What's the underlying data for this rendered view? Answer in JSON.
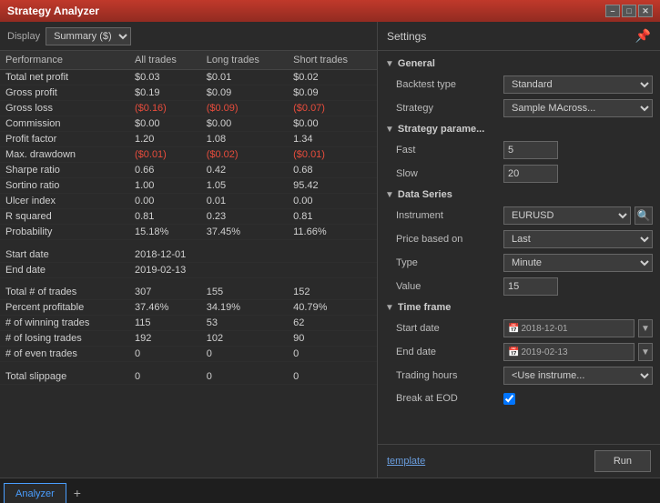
{
  "window": {
    "title": "Strategy Analyzer"
  },
  "toolbar": {
    "display_label": "Display",
    "summary_option": "Summary ($)"
  },
  "table": {
    "headers": [
      "Performance",
      "All trades",
      "Long trades",
      "Short trades"
    ],
    "section_performance": "Performance",
    "rows": [
      {
        "label": "Total net profit",
        "all": "$0.03",
        "long": "$0.01",
        "short": "$0.02",
        "all_red": false,
        "long_red": false,
        "short_red": false
      },
      {
        "label": "Gross profit",
        "all": "$0.19",
        "long": "$0.09",
        "short": "$0.09",
        "all_red": false,
        "long_red": false,
        "short_red": false
      },
      {
        "label": "Gross loss",
        "all": "($0.16)",
        "long": "($0.09)",
        "short": "($0.07)",
        "all_red": true,
        "long_red": true,
        "short_red": true
      },
      {
        "label": "Commission",
        "all": "$0.00",
        "long": "$0.00",
        "short": "$0.00",
        "all_red": false,
        "long_red": false,
        "short_red": false
      },
      {
        "label": "Profit factor",
        "all": "1.20",
        "long": "1.08",
        "short": "1.34",
        "all_red": false,
        "long_red": false,
        "short_red": false
      },
      {
        "label": "Max. drawdown",
        "all": "($0.01)",
        "long": "($0.02)",
        "short": "($0.01)",
        "all_red": true,
        "long_red": true,
        "short_red": true
      },
      {
        "label": "Sharpe ratio",
        "all": "0.66",
        "long": "0.42",
        "short": "0.68",
        "all_red": false,
        "long_red": false,
        "short_red": false
      },
      {
        "label": "Sortino ratio",
        "all": "1.00",
        "long": "1.05",
        "short": "95.42",
        "all_red": false,
        "long_red": false,
        "short_red": false
      },
      {
        "label": "Ulcer index",
        "all": "0.00",
        "long": "0.01",
        "short": "0.00",
        "all_red": false,
        "long_red": false,
        "short_red": false
      },
      {
        "label": "R squared",
        "all": "0.81",
        "long": "0.23",
        "short": "0.81",
        "all_red": false,
        "long_red": false,
        "short_red": false
      },
      {
        "label": "Probability",
        "all": "15.18%",
        "long": "37.45%",
        "short": "11.66%",
        "all_red": false,
        "long_red": false,
        "short_red": false
      }
    ],
    "dates": [
      {
        "label": "Start date",
        "value": "2018-12-01"
      },
      {
        "label": "End date",
        "value": "2019-02-13"
      }
    ],
    "trade_rows": [
      {
        "label": "Total # of trades",
        "all": "307",
        "long": "155",
        "short": "152"
      },
      {
        "label": "Percent profitable",
        "all": "37.46%",
        "long": "34.19%",
        "short": "40.79%"
      },
      {
        "label": "# of winning trades",
        "all": "115",
        "long": "53",
        "short": "62"
      },
      {
        "label": "# of losing trades",
        "all": "192",
        "long": "102",
        "short": "90"
      },
      {
        "label": "# of even trades",
        "all": "0",
        "long": "0",
        "short": "0"
      }
    ],
    "slippage": {
      "label": "Total slippage",
      "all": "0",
      "long": "0",
      "short": "0"
    }
  },
  "settings": {
    "title": "Settings",
    "sections": {
      "general": {
        "label": "General",
        "backtest_type_label": "Backtest type",
        "backtest_type_value": "Standard",
        "strategy_label": "Strategy",
        "strategy_value": "Sample MAcross..."
      },
      "strategy_params": {
        "label": "Strategy parame...",
        "fast_label": "Fast",
        "fast_value": "5",
        "slow_label": "Slow",
        "slow_value": "20"
      },
      "data_series": {
        "label": "Data Series",
        "instrument_label": "Instrument",
        "instrument_value": "EURUSD",
        "price_based_label": "Price based on",
        "price_based_value": "Last",
        "type_label": "Type",
        "type_value": "Minute",
        "value_label": "Value",
        "value_value": "15"
      },
      "time_frame": {
        "label": "Time frame",
        "start_date_label": "Start date",
        "start_date_value": "2018-12-01",
        "end_date_label": "End date",
        "end_date_value": "2019-02-13",
        "trading_hours_label": "Trading hours",
        "trading_hours_value": "<Use instrume...",
        "break_at_eod_label": "Break at EOD"
      }
    },
    "template_link": "template",
    "run_btn": "Run"
  },
  "tabs": [
    {
      "label": "Analyzer",
      "active": true
    },
    {
      "label": "+",
      "is_add": true
    }
  ]
}
